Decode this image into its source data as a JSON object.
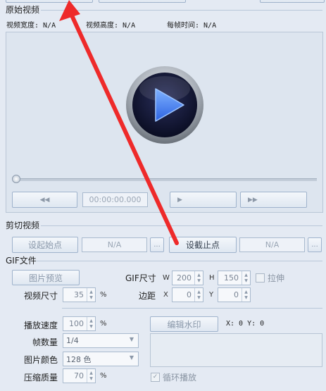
{
  "original_video": {
    "section_title": "原始视频",
    "width_label": "视频宽度: N/A",
    "height_label": "视频高度: N/A",
    "frame_time_label": "每帧时间: N/A",
    "timecode": "00:00:00.000"
  },
  "cut_video": {
    "section_title": "剪切视频",
    "set_start_label": "设起始点",
    "start_value": "N/A",
    "more": "...",
    "set_end_label": "设截止点",
    "end_value": "N/A"
  },
  "gif_file": {
    "section_title": "GIF文件",
    "preview_label": "图片预览",
    "gif_size_label": "GIF尺寸",
    "w_label": "W",
    "h_label": "H",
    "w_value": "200",
    "h_value": "150",
    "stretch_label": "拉伸",
    "video_size_label": "视频尺寸",
    "video_size_value": "35",
    "percent": "%",
    "margin_label": "边距",
    "x_label": "X",
    "y_label": "Y",
    "margin_x": "0",
    "margin_y": "0",
    "speed_label": "播放速度",
    "speed_value": "100",
    "frame_count_label": "帧数量",
    "frame_count_value": "1/4",
    "color_label": "图片颜色",
    "color_value": "128 色",
    "quality_label": "压缩质量",
    "quality_value": "70",
    "watermark_label": "编辑水印",
    "watermark_coords": "X: 0  Y: 0",
    "loop_label": "循环播放"
  },
  "colors": {
    "arrow": "#ee2a2a",
    "accent": "#2f6be0"
  },
  "icons": [
    "rewind-icon",
    "play-icon",
    "fast-forward-icon",
    "big-play-icon"
  ]
}
